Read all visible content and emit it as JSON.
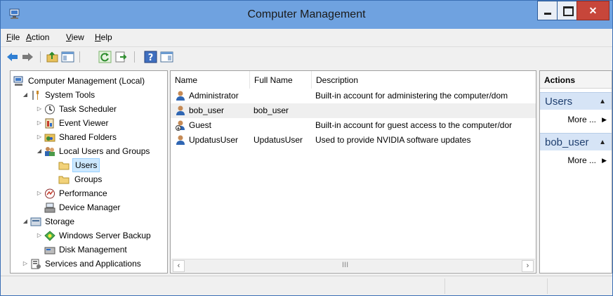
{
  "window": {
    "title": "Computer Management"
  },
  "menu": [
    "File",
    "Action",
    "View",
    "Help"
  ],
  "toolbar": [
    "back-icon",
    "forward-icon",
    "up-folder-icon",
    "show-hide-console-tree-icon",
    "refresh-icon",
    "export-list-icon",
    "help-icon",
    "show-hide-action-pane-icon"
  ],
  "tree": [
    {
      "label": "Computer Management (Local)",
      "icon": "computer-management-icon"
    },
    {
      "label": "System Tools",
      "icon": "system-tools-icon"
    },
    {
      "label": "Task Scheduler",
      "icon": "task-scheduler-icon"
    },
    {
      "label": "Event Viewer",
      "icon": "event-viewer-icon"
    },
    {
      "label": "Shared Folders",
      "icon": "shared-folders-icon"
    },
    {
      "label": "Local Users and Groups",
      "icon": "local-users-groups-icon"
    },
    {
      "label": "Users",
      "icon": "folder-icon"
    },
    {
      "label": "Groups",
      "icon": "folder-icon"
    },
    {
      "label": "Performance",
      "icon": "performance-icon"
    },
    {
      "label": "Device Manager",
      "icon": "device-manager-icon"
    },
    {
      "label": "Storage",
      "icon": "storage-icon"
    },
    {
      "label": "Windows Server Backup",
      "icon": "windows-server-backup-icon"
    },
    {
      "label": "Disk Management",
      "icon": "disk-management-icon"
    },
    {
      "label": "Services and Applications",
      "icon": "services-applications-icon"
    }
  ],
  "list": {
    "columns": [
      "Name",
      "Full Name",
      "Description"
    ],
    "rows": [
      {
        "name": "Administrator",
        "full_name": "",
        "description": "Built-in account for administering the computer/dom"
      },
      {
        "name": "bob_user",
        "full_name": "bob_user",
        "description": ""
      },
      {
        "name": "Guest",
        "full_name": "",
        "description": "Built-in account for guest access to the computer/dor"
      },
      {
        "name": "UpdatusUser",
        "full_name": "UpdatusUser",
        "description": "Used to provide NVIDIA software updates"
      }
    ],
    "scroll_grip": "III"
  },
  "actions": {
    "header": "Actions",
    "sections": [
      {
        "title": "Users",
        "more": "More ..."
      },
      {
        "title": "bob_user",
        "more": "More ..."
      }
    ]
  }
}
